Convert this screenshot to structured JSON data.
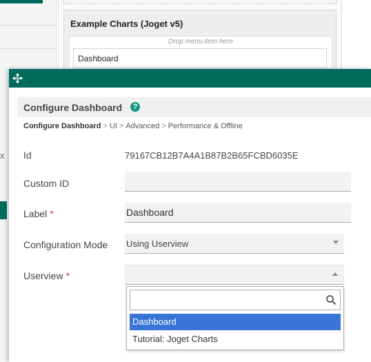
{
  "background": {
    "panel_title": "Example Charts (Joget v5)",
    "drop_hint": "Drop menu item here",
    "menu_item": "Dashboard",
    "sidebar_fragment": "x"
  },
  "dialog": {
    "move_icon": "move-arrows-icon",
    "title": "Configure Dashboard",
    "help_icon": "?",
    "breadcrumb": [
      "Configure Dashboard",
      "UI",
      "Advanced",
      "Performance & Offline"
    ],
    "breadcrumb_separator": ">",
    "fields": {
      "id": {
        "label": "Id",
        "value": "79167CB12B7A4A1B87B2B65FCBD6035E"
      },
      "custom_id": {
        "label": "Custom ID",
        "value": ""
      },
      "label": {
        "label": "Label",
        "required_mark": "*",
        "value": "Dashboard"
      },
      "configuration_mode": {
        "label": "Configuration Mode",
        "value": "Using Userview"
      },
      "userview": {
        "label": "Userview",
        "required_mark": "*",
        "value": ""
      }
    },
    "dropdown": {
      "search_value": "",
      "options": [
        "Dashboard",
        "Tutorial: Joget Charts"
      ],
      "highlighted_index": 0
    }
  },
  "colors": {
    "brand_green": "#006b5a",
    "help_teal": "#12997d",
    "highlight_blue": "#3875d7",
    "required_red": "#c0392b"
  }
}
